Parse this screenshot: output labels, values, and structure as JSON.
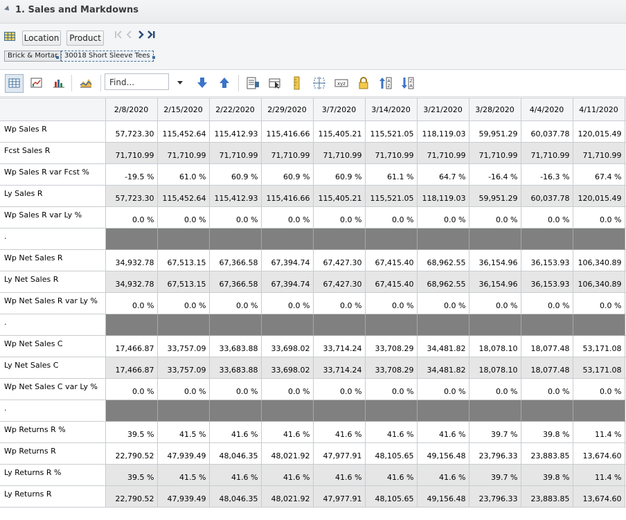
{
  "header": {
    "title": "1. Sales and Markdowns"
  },
  "navbar": {
    "location_label": "Location",
    "product_label": "Product",
    "breadcrumbs": [
      "Brick & Mortar",
      "30018 Short Sleeve Tees"
    ]
  },
  "toolbar": {
    "find_placeholder": "Find...",
    "icons": [
      "grid-view-icon",
      "chart-grid-icon",
      "bar-chart-icon",
      "area-chart-icon",
      "find-dropdown-icon",
      "find-next-icon",
      "find-previous-icon",
      "show-measures-icon",
      "select-view-icon",
      "ruler-icon",
      "split-view-icon",
      "xyz-icon",
      "lock-icon",
      "sort-ascending-icon",
      "sort-descending-icon"
    ]
  },
  "colors": {
    "accent": "#3f6e9b",
    "divider_row": "#808080",
    "alt_row": "#e6e6e6"
  },
  "grid": {
    "columns": [
      "2/8/2020",
      "2/15/2020",
      "2/22/2020",
      "2/29/2020",
      "3/7/2020",
      "3/14/2020",
      "3/21/2020",
      "3/28/2020",
      "4/4/2020",
      "4/11/2020"
    ],
    "rows": [
      {
        "label": "Wp Sales R",
        "values": [
          "57,723.30",
          "115,452.64",
          "115,412.93",
          "115,416.66",
          "115,405.21",
          "115,521.05",
          "118,119.03",
          "59,951.29",
          "60,037.78",
          "120,015.49"
        ]
      },
      {
        "label": "Fcst Sales R",
        "values": [
          "71,710.99",
          "71,710.99",
          "71,710.99",
          "71,710.99",
          "71,710.99",
          "71,710.99",
          "71,710.99",
          "71,710.99",
          "71,710.99",
          "71,710.99"
        ]
      },
      {
        "label": "Wp Sales R var Fcst %",
        "values": [
          "-19.5 %",
          "61.0 %",
          "60.9 %",
          "60.9 %",
          "60.9 %",
          "61.1 %",
          "64.7 %",
          "-16.4 %",
          "-16.3 %",
          "67.4 %"
        ]
      },
      {
        "label": "Ly Sales R",
        "values": [
          "57,723.30",
          "115,452.64",
          "115,412.93",
          "115,416.66",
          "115,405.21",
          "115,521.05",
          "118,119.03",
          "59,951.29",
          "60,037.78",
          "120,015.49"
        ]
      },
      {
        "label": "Wp Sales R var Ly %",
        "values": [
          "0.0 %",
          "0.0 %",
          "0.0 %",
          "0.0 %",
          "0.0 %",
          "0.0 %",
          "0.0 %",
          "0.0 %",
          "0.0 %",
          "0.0 %"
        ]
      },
      {
        "label": ".",
        "values": [
          "",
          "",
          "",
          "",
          "",
          "",
          "",
          "",
          "",
          ""
        ]
      },
      {
        "label": "Wp Net Sales R",
        "values": [
          "34,932.78",
          "67,513.15",
          "67,366.58",
          "67,394.74",
          "67,427.30",
          "67,415.40",
          "68,962.55",
          "36,154.96",
          "36,153.93",
          "106,340.89"
        ]
      },
      {
        "label": "Ly Net Sales R",
        "values": [
          "34,932.78",
          "67,513.15",
          "67,366.58",
          "67,394.74",
          "67,427.30",
          "67,415.40",
          "68,962.55",
          "36,154.96",
          "36,153.93",
          "106,340.89"
        ]
      },
      {
        "label": "Wp Net Sales R var Ly %",
        "values": [
          "0.0 %",
          "0.0 %",
          "0.0 %",
          "0.0 %",
          "0.0 %",
          "0.0 %",
          "0.0 %",
          "0.0 %",
          "0.0 %",
          "0.0 %"
        ]
      },
      {
        "label": ".",
        "values": [
          "",
          "",
          "",
          "",
          "",
          "",
          "",
          "",
          "",
          ""
        ]
      },
      {
        "label": "Wp Net Sales C",
        "values": [
          "17,466.87",
          "33,757.09",
          "33,683.88",
          "33,698.02",
          "33,714.24",
          "33,708.29",
          "34,481.82",
          "18,078.10",
          "18,077.48",
          "53,171.08"
        ]
      },
      {
        "label": "Ly Net Sales C",
        "values": [
          "17,466.87",
          "33,757.09",
          "33,683.88",
          "33,698.02",
          "33,714.24",
          "33,708.29",
          "34,481.82",
          "18,078.10",
          "18,077.48",
          "53,171.08"
        ]
      },
      {
        "label": "Wp Net Sales C var Ly %",
        "values": [
          "0.0 %",
          "0.0 %",
          "0.0 %",
          "0.0 %",
          "0.0 %",
          "0.0 %",
          "0.0 %",
          "0.0 %",
          "0.0 %",
          "0.0 %"
        ]
      },
      {
        "label": ".",
        "values": [
          "",
          "",
          "",
          "",
          "",
          "",
          "",
          "",
          "",
          ""
        ]
      },
      {
        "label": "Wp Returns R %",
        "values": [
          "39.5 %",
          "41.5 %",
          "41.6 %",
          "41.6 %",
          "41.6 %",
          "41.6 %",
          "41.6 %",
          "39.7 %",
          "39.8 %",
          "11.4 %"
        ]
      },
      {
        "label": "Wp Returns R",
        "values": [
          "22,790.52",
          "47,939.49",
          "48,046.35",
          "48,021.92",
          "47,977.91",
          "48,105.65",
          "49,156.48",
          "23,796.33",
          "23,883.85",
          "13,674.60"
        ]
      },
      {
        "label": "Ly Returns R %",
        "values": [
          "39.5 %",
          "41.5 %",
          "41.6 %",
          "41.6 %",
          "41.6 %",
          "41.6 %",
          "41.6 %",
          "39.7 %",
          "39.8 %",
          "11.4 %"
        ]
      },
      {
        "label": "Ly Returns R",
        "values": [
          "22,790.52",
          "47,939.49",
          "48,046.35",
          "48,021.92",
          "47,977.91",
          "48,105.65",
          "49,156.48",
          "23,796.33",
          "23,883.85",
          "13,674.60"
        ]
      }
    ]
  }
}
